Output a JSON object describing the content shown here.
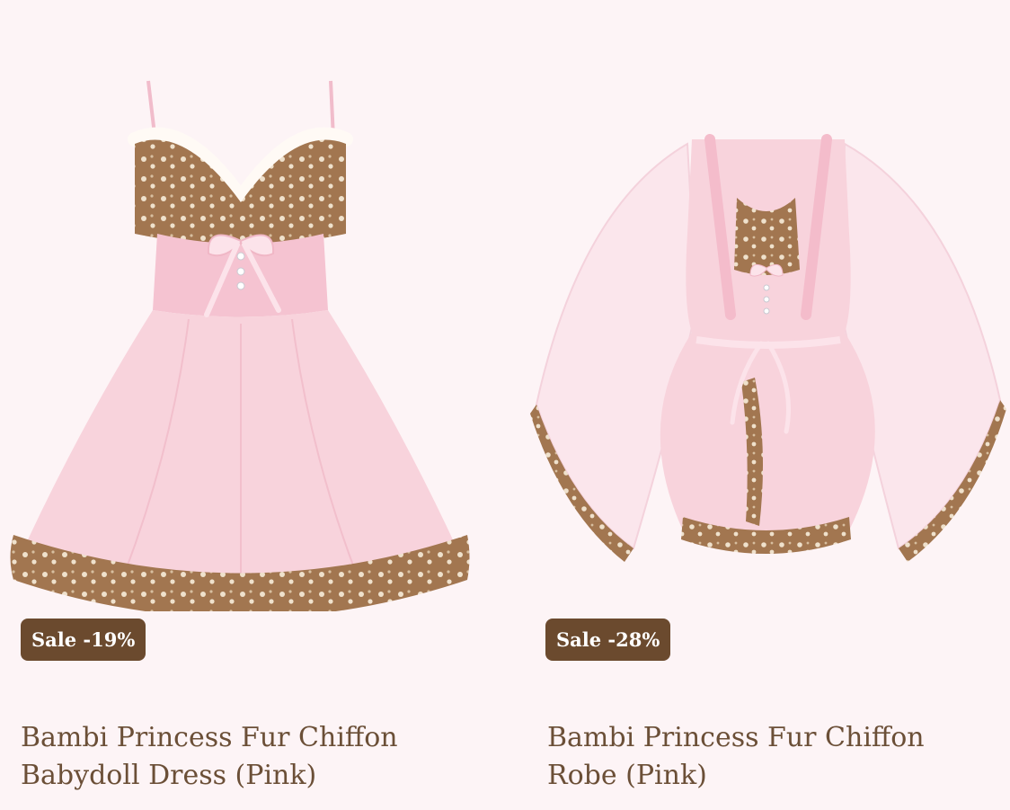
{
  "products": [
    {
      "image_icon": "babydoll-dress-image",
      "badge": "Sale -19%",
      "title_line1": "Bambi Princess Fur Chiffon",
      "title_line2": "Babydoll Dress (Pink)"
    },
    {
      "image_icon": "robe-image",
      "badge": "Sale -28%",
      "title_line1": "Bambi Princess Fur Chiffon",
      "title_line2": "Robe (Pink)"
    }
  ],
  "colors": {
    "background": "#fdf4f6",
    "badge_bg": "#6b4a2e",
    "badge_text": "#ffffff",
    "title_text": "#6b4f37",
    "chiffon_pink": "#f8d3dc",
    "fur_brown": "#a27650"
  }
}
